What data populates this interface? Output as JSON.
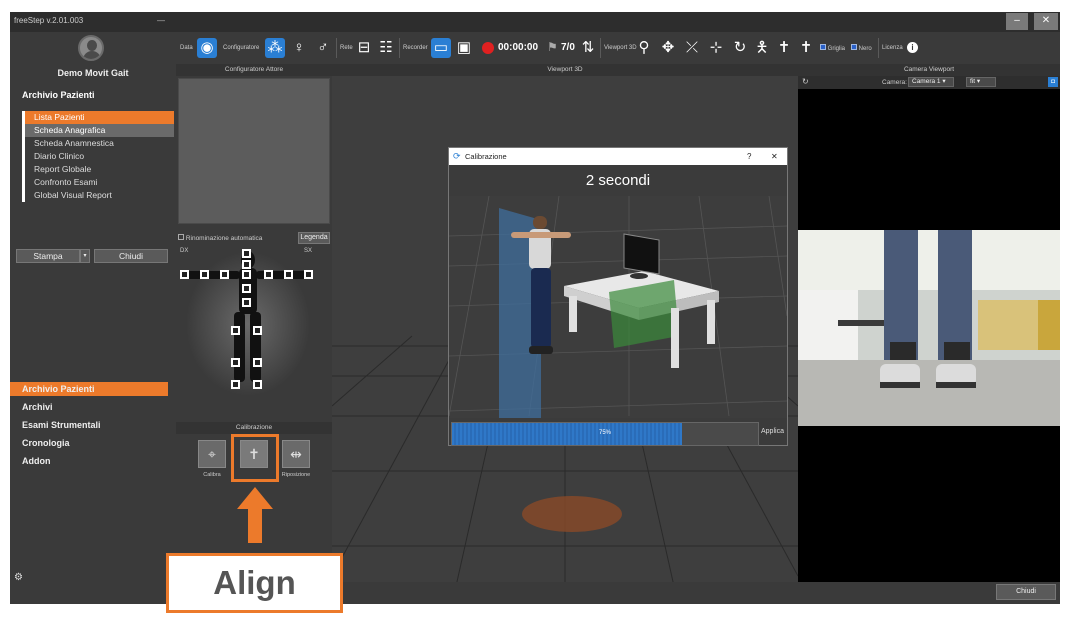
{
  "app": {
    "title": "freeStep v.2.01.003",
    "pin": "—",
    "min": "–",
    "close": "✕"
  },
  "sidebar": {
    "user_name": "Demo Movit Gait",
    "section_title": "Archivio Pazienti",
    "items": [
      {
        "label": "Lista Pazienti"
      },
      {
        "label": "Scheda Anagrafica"
      },
      {
        "label": "Scheda Anamnestica"
      },
      {
        "label": "Diario Clinico"
      },
      {
        "label": "Report Globale"
      },
      {
        "label": "Confronto Esami"
      },
      {
        "label": "Global Visual Report"
      }
    ],
    "print_label": "Stampa",
    "close_label": "Chiudi",
    "nav": [
      {
        "label": "Archivio Pazienti"
      },
      {
        "label": "Archivi"
      },
      {
        "label": "Esami Strumentali"
      },
      {
        "label": "Cronologia"
      },
      {
        "label": "Addon"
      }
    ]
  },
  "toolbar": {
    "data_label": "Data",
    "config_label": "Configuratore",
    "net_label": "Rete",
    "recorder_label": "Recorder",
    "timer": "00:00:00",
    "flag_count": "7/0",
    "viewport_label": "Viewport 3D",
    "grid_label": "Griglia",
    "black_label": "Nero",
    "license_label": "Licenza",
    "accent": "#2a7fd4",
    "record_color": "#e02020"
  },
  "actor_panel": {
    "title": "Configuratore Attore",
    "auto_rename": "Rinominazione automatica",
    "legend": "Legenda",
    "dx": "DX",
    "sx": "SX",
    "calibration_title": "Calibrazione",
    "calibrate_label": "Calibra",
    "reposition_label": "Riposizione"
  },
  "viewport": {
    "title": "Viewport 3D"
  },
  "camera": {
    "title": "Camera Viewport",
    "camera_prefix": "Camera:",
    "camera_value": "Camera 1",
    "fit_value": "fit"
  },
  "dialog": {
    "title": "Calibrazione",
    "help": "?",
    "close": "✕",
    "countdown": "2 secondi",
    "progress_value": 75,
    "progress_text": "75%",
    "apply": "Applica"
  },
  "bottom": {
    "close_label": "Chiudi"
  },
  "annotation": {
    "label": "Align",
    "color": "#ec7a2b"
  }
}
